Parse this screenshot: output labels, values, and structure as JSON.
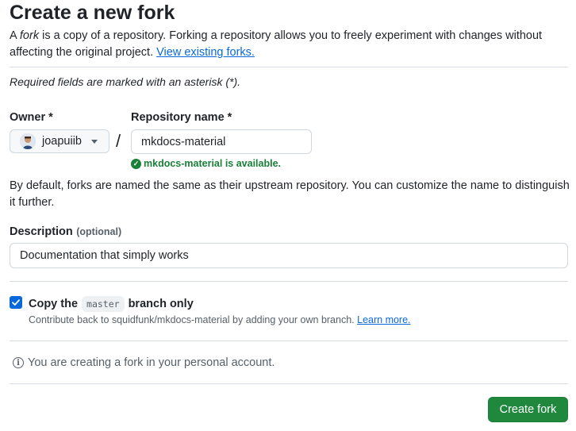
{
  "page": {
    "title": "Create a new fork",
    "intro_prefix": "A ",
    "intro_em": "fork",
    "intro_suffix": " is a copy of a repository. Forking a repository allows you to freely experiment with changes without affecting the original project. ",
    "existing_forks_link": "View existing forks.",
    "required_note": "Required fields are marked with an asterisk (*)."
  },
  "owner": {
    "label": "Owner *",
    "value": "joapuiib",
    "icon": "chevron-down-icon"
  },
  "repo": {
    "separator": "/",
    "label": "Repository name *",
    "value": "mkdocs-material",
    "availability": "mkdocs-material is available.",
    "availability_color": "#1a7f37"
  },
  "naming_note": "By default, forks are named the same as their upstream repository. You can customize the name to distinguish it further.",
  "description": {
    "label": "Description",
    "optional": "(optional)",
    "value": "Documentation that simply works"
  },
  "copy_branch": {
    "checked": true,
    "label_prefix": "Copy the",
    "branch": "master",
    "label_suffix": "branch only",
    "hint": "Contribute back to squidfunk/mkdocs-material by adding your own branch.",
    "learn_more": "Learn more."
  },
  "info": {
    "text": "You are creating a fork in your personal account.",
    "icon": "info-icon"
  },
  "actions": {
    "create_label": "Create fork",
    "create_color": "#1f883d"
  }
}
